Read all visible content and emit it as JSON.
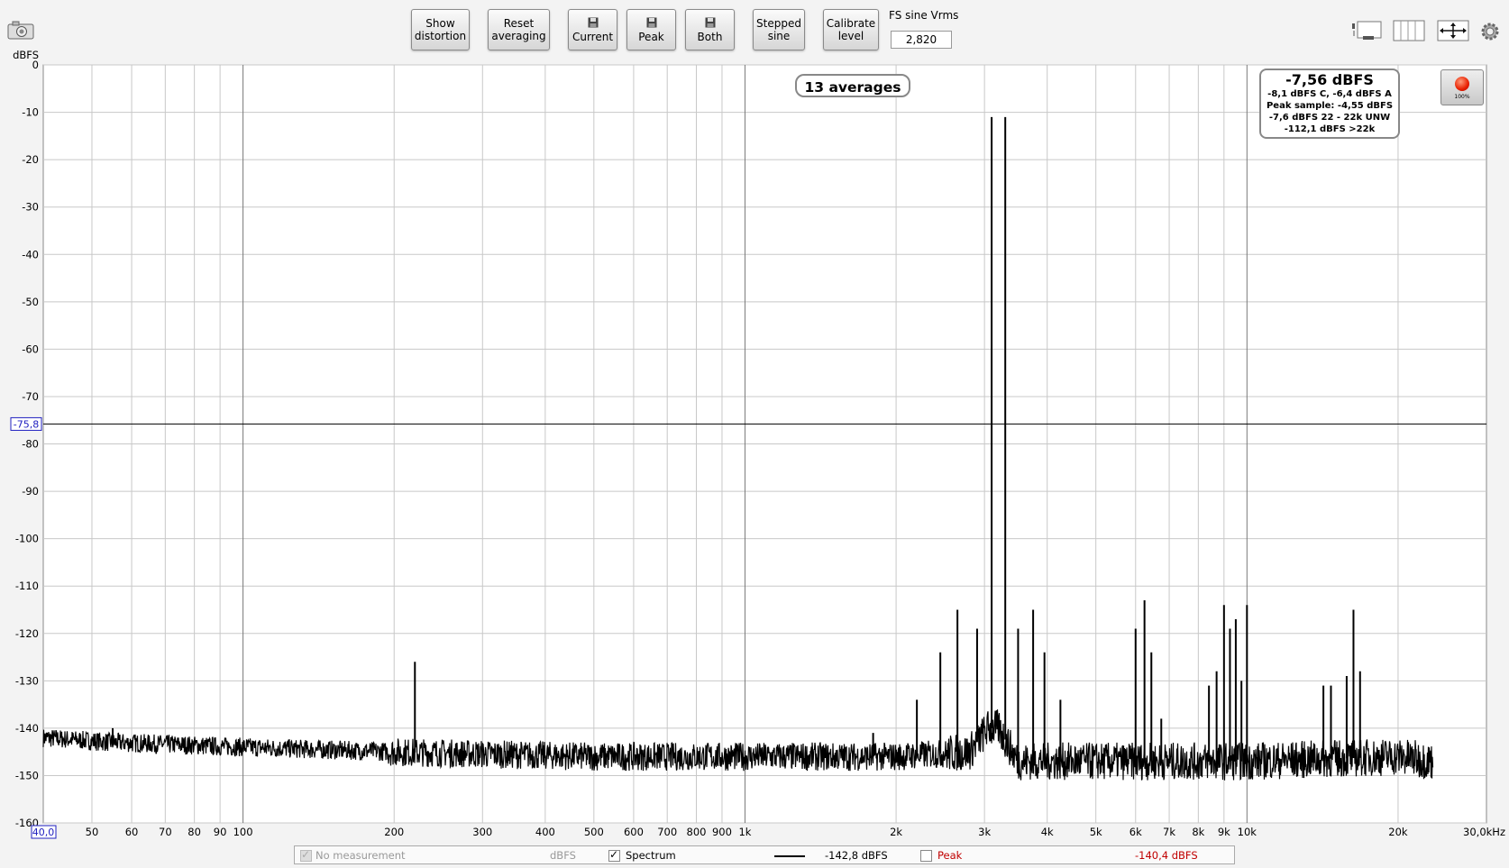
{
  "toolbar": {
    "show_distortion": "Show\ndistortion",
    "reset_averaging": "Reset\naveraging",
    "save_current": "Current",
    "save_peak": "Peak",
    "save_both": "Both",
    "stepped_sine": "Stepped\nsine",
    "calibrate_level": "Calibrate\nlevel",
    "fs_sine_label": "FS sine Vrms",
    "fs_sine_value": "2,820"
  },
  "badges": {
    "averages": "13 averages"
  },
  "level_panel": {
    "main": "-7,56 dBFS",
    "line1": "-8,1 dBFS C, -6,4 dBFS A",
    "line2": "Peak sample: -4,55 dBFS",
    "line3": "-7,6 dBFS 22 - 22k UNW",
    "line4": "-112,1 dBFS >22k",
    "record_pct": "100%"
  },
  "cursor": {
    "y_label": "-75,8",
    "y_value": -75.8
  },
  "legend": {
    "no_measurement": "No measurement",
    "no_measurement_unit": "dBFS",
    "spectrum": "Spectrum",
    "spectrum_value": "-142,8 dBFS",
    "peak": "Peak",
    "peak_value": "-140,4 dBFS"
  },
  "colors": {
    "peak": "#c00000",
    "cursor_label": "#2020c0",
    "trace": "#000000"
  },
  "chart_data": {
    "type": "line",
    "title": "",
    "ylabel": "dBFS",
    "xlabel": "",
    "x_scale": "log",
    "xlim": [
      40,
      30000
    ],
    "ylim": [
      -160,
      0
    ],
    "grid": true,
    "y_ticks": [
      0,
      -10,
      -20,
      -30,
      -40,
      -50,
      -60,
      -70,
      -80,
      -90,
      -100,
      -110,
      -120,
      -130,
      -140,
      -150,
      -160
    ],
    "y_tick_labels": [
      "0",
      "-10",
      "-20",
      "-30",
      "-40",
      "-50",
      "-60",
      "-70",
      "-80",
      "-90",
      "-100",
      "-110",
      "-120",
      "-130",
      "-140",
      "-150",
      "-160"
    ],
    "x_ticks": [
      50,
      60,
      70,
      80,
      90,
      100,
      200,
      300,
      400,
      500,
      600,
      700,
      800,
      900,
      1000,
      2000,
      3000,
      4000,
      5000,
      6000,
      7000,
      8000,
      9000,
      10000,
      20000
    ],
    "x_tick_labels": [
      "50",
      "60",
      "70",
      "80",
      "90",
      "100",
      "200",
      "300",
      "400",
      "500",
      "600",
      "700",
      "800",
      "900",
      "1k",
      "2k",
      "3k",
      "4k",
      "5k",
      "6k",
      "7k",
      "8k",
      "9k",
      "10k",
      "20k"
    ],
    "x_start_label": "40,0",
    "x_end_label": "30,0kHz",
    "noise_floor": [
      {
        "f": 40,
        "db": -142
      },
      {
        "f": 55,
        "db": -143
      },
      {
        "f": 100,
        "db": -144
      },
      {
        "f": 200,
        "db": -145
      },
      {
        "f": 500,
        "db": -146
      },
      {
        "f": 1000,
        "db": -146
      },
      {
        "f": 2000,
        "db": -146
      },
      {
        "f": 2800,
        "db": -145
      },
      {
        "f": 3050,
        "db": -140
      },
      {
        "f": 3200,
        "db": -140
      },
      {
        "f": 3500,
        "db": -147
      },
      {
        "f": 10000,
        "db": -147
      },
      {
        "f": 20000,
        "db": -146
      },
      {
        "f": 23500,
        "db": -147
      }
    ],
    "peaks": [
      {
        "f": 55,
        "db": -140
      },
      {
        "f": 220,
        "db": -126
      },
      {
        "f": 1800,
        "db": -141
      },
      {
        "f": 2200,
        "db": -134
      },
      {
        "f": 2450,
        "db": -124
      },
      {
        "f": 2650,
        "db": -115
      },
      {
        "f": 2900,
        "db": -119
      },
      {
        "f": 3100,
        "db": -11
      },
      {
        "f": 3300,
        "db": -11
      },
      {
        "f": 3500,
        "db": -119
      },
      {
        "f": 3750,
        "db": -115
      },
      {
        "f": 3950,
        "db": -124
      },
      {
        "f": 4250,
        "db": -134
      },
      {
        "f": 6000,
        "db": -119
      },
      {
        "f": 6250,
        "db": -113
      },
      {
        "f": 6450,
        "db": -124
      },
      {
        "f": 6750,
        "db": -138
      },
      {
        "f": 8400,
        "db": -131
      },
      {
        "f": 8700,
        "db": -128
      },
      {
        "f": 9000,
        "db": -114
      },
      {
        "f": 9250,
        "db": -119
      },
      {
        "f": 9500,
        "db": -117
      },
      {
        "f": 9750,
        "db": -130
      },
      {
        "f": 10000,
        "db": -114
      },
      {
        "f": 14200,
        "db": -131
      },
      {
        "f": 14700,
        "db": -131
      },
      {
        "f": 15800,
        "db": -129
      },
      {
        "f": 16300,
        "db": -115
      },
      {
        "f": 16800,
        "db": -128
      }
    ]
  }
}
